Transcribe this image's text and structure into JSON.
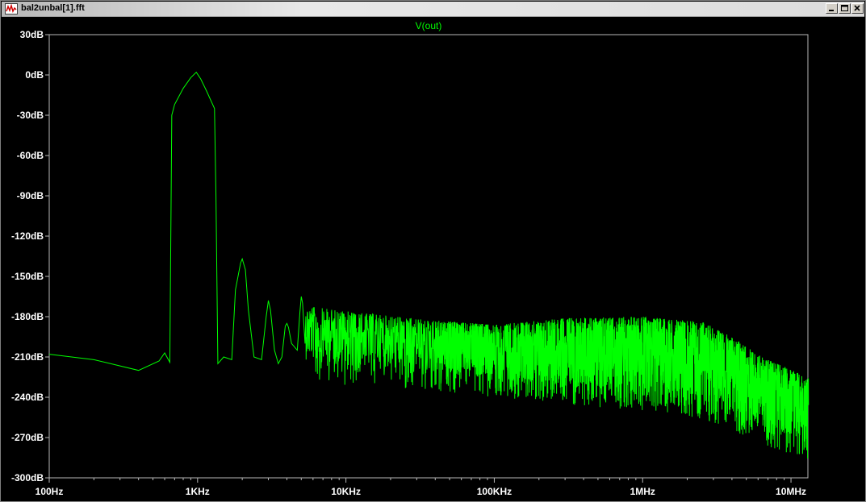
{
  "window": {
    "title": "bal2unbal[1].fft",
    "icons": [
      "waveform-icon",
      "minimize-icon",
      "maximize-icon",
      "close-icon"
    ]
  },
  "colors": {
    "background": "#000000",
    "axis": "#b8b8b8",
    "trace": "#00ff00",
    "label": "#ffffff"
  },
  "chart_data": {
    "type": "line",
    "title": "V(out)",
    "xlabel": "",
    "ylabel": "",
    "x_scale": "log",
    "xlim": [
      100,
      13000000
    ],
    "ylim": [
      -300,
      30
    ],
    "y_ticks": [
      30,
      0,
      -30,
      -60,
      -90,
      -120,
      -150,
      -180,
      -210,
      -240,
      -270,
      -300
    ],
    "y_tick_labels": [
      "30dB",
      "0dB",
      "-30dB",
      "-60dB",
      "-90dB",
      "-120dB",
      "-150dB",
      "-180dB",
      "-210dB",
      "-240dB",
      "-270dB",
      "-300dB"
    ],
    "x_ticks": [
      100,
      1000,
      10000,
      100000,
      1000000,
      10000000
    ],
    "x_tick_labels": [
      "100Hz",
      "1KHz",
      "10KHz",
      "100KHz",
      "1MHz",
      "10MHz"
    ],
    "grid": false,
    "series": [
      {
        "name": "V(out)",
        "color": "#00ff00",
        "x": [
          100,
          200,
          400,
          550,
          600,
          650,
          670,
          700,
          800,
          900,
          980,
          1050,
          1150,
          1300,
          1330,
          1370,
          1500,
          1700,
          1800,
          1950,
          2000,
          2100,
          2200,
          2400,
          2700,
          2900,
          3000,
          3100,
          3300,
          3500,
          3700,
          3900,
          4000,
          4100,
          4300,
          4700,
          4900,
          5000,
          5100,
          5300
        ],
        "y": [
          -208,
          -212,
          -220,
          -213,
          -207,
          -214,
          -30,
          -22,
          -10,
          -2,
          2,
          -3,
          -12,
          -25,
          -90,
          -215,
          -210,
          -212,
          -160,
          -140,
          -137,
          -145,
          -175,
          -210,
          -212,
          -180,
          -168,
          -175,
          -205,
          -215,
          -210,
          -187,
          -185,
          -188,
          -200,
          -205,
          -176,
          -165,
          -170,
          -200
        ]
      }
    ],
    "annotations": []
  }
}
